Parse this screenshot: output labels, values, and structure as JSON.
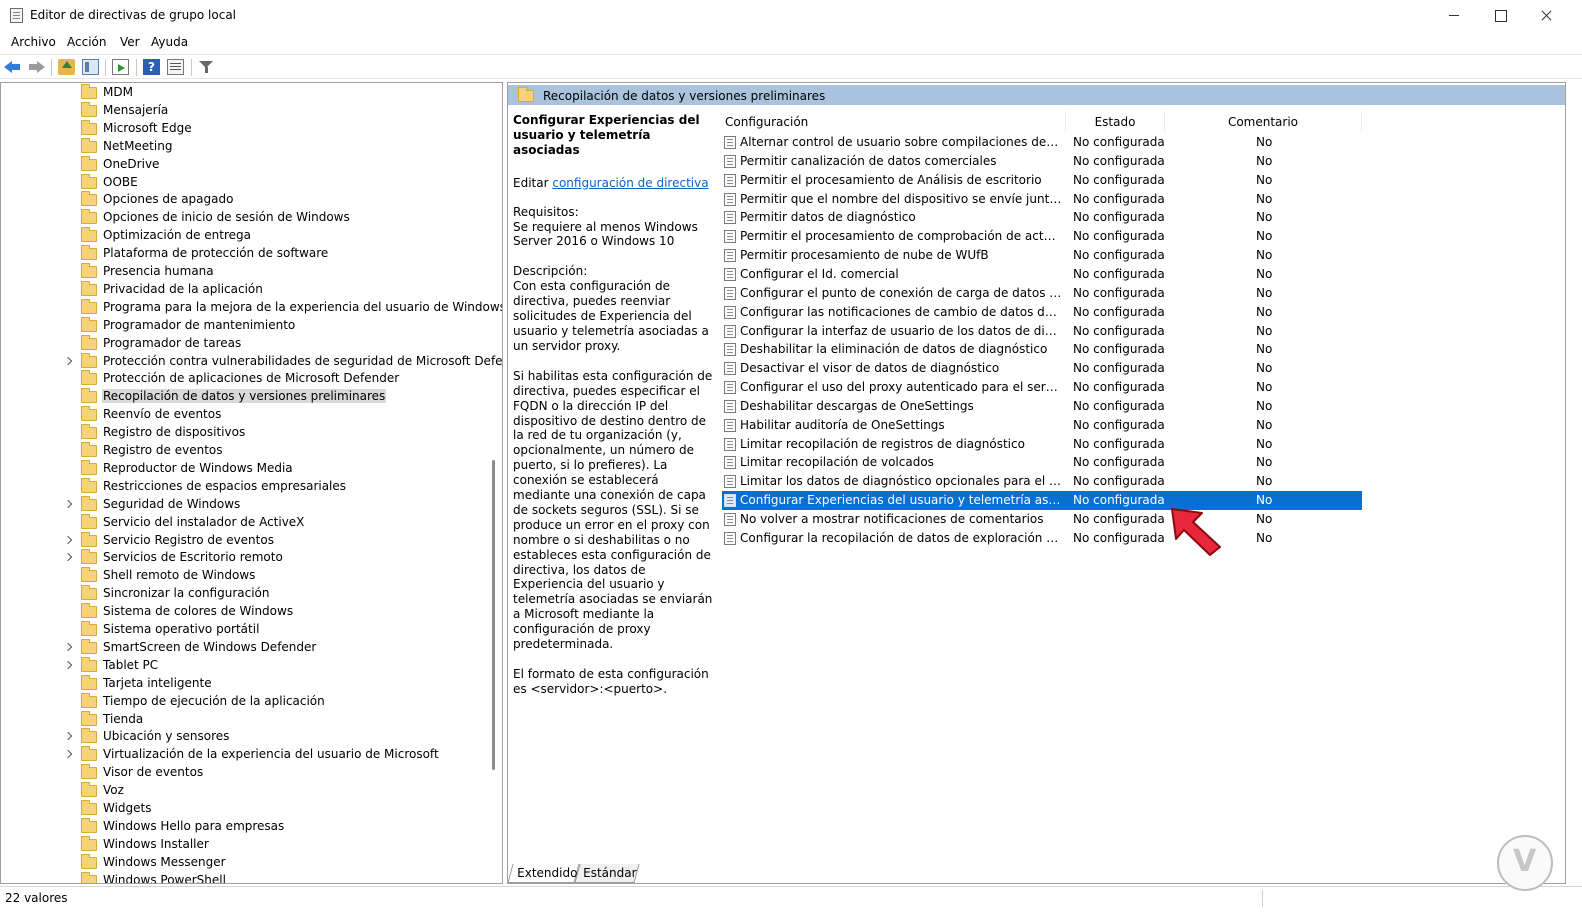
{
  "window": {
    "title": "Editor de directivas de grupo local"
  },
  "menu": [
    "Archivo",
    "Acción",
    "Ver",
    "Ayuda"
  ],
  "toolbar": {
    "icons": [
      "back-arrow",
      "forward-arrow",
      "up-folder",
      "show-hide-tree",
      "export-list",
      "help",
      "properties",
      "filter"
    ],
    "help_glyph": "?"
  },
  "tree": {
    "items": [
      {
        "label": "MDM",
        "expandable": false
      },
      {
        "label": "Mensajería",
        "expandable": false
      },
      {
        "label": "Microsoft Edge",
        "expandable": false
      },
      {
        "label": "NetMeeting",
        "expandable": false
      },
      {
        "label": "OneDrive",
        "expandable": false
      },
      {
        "label": "OOBE",
        "expandable": false
      },
      {
        "label": "Opciones de apagado",
        "expandable": false
      },
      {
        "label": "Opciones de inicio de sesión de Windows",
        "expandable": false
      },
      {
        "label": "Optimización de entrega",
        "expandable": false
      },
      {
        "label": "Plataforma de protección de software",
        "expandable": false
      },
      {
        "label": "Presencia humana",
        "expandable": false
      },
      {
        "label": "Privacidad de la aplicación",
        "expandable": false
      },
      {
        "label": "Programa para la mejora de la experiencia del usuario de Windows",
        "expandable": false
      },
      {
        "label": "Programador de mantenimiento",
        "expandable": false
      },
      {
        "label": "Programador de tareas",
        "expandable": false
      },
      {
        "label": "Protección contra vulnerabilidades de seguridad de Microsoft Defender",
        "expandable": true
      },
      {
        "label": "Protección de aplicaciones de Microsoft Defender",
        "expandable": false
      },
      {
        "label": "Recopilación de datos y versiones preliminares",
        "expandable": false,
        "selected": true
      },
      {
        "label": "Reenvío de eventos",
        "expandable": false
      },
      {
        "label": "Registro de dispositivos",
        "expandable": false
      },
      {
        "label": "Registro de eventos",
        "expandable": false
      },
      {
        "label": "Reproductor de Windows Media",
        "expandable": false
      },
      {
        "label": "Restricciones de espacios empresariales",
        "expandable": false
      },
      {
        "label": "Seguridad de Windows",
        "expandable": true
      },
      {
        "label": "Servicio del instalador de ActiveX",
        "expandable": false
      },
      {
        "label": "Servicio Registro de eventos",
        "expandable": true
      },
      {
        "label": "Servicios de Escritorio remoto",
        "expandable": true
      },
      {
        "label": "Shell remoto de Windows",
        "expandable": false
      },
      {
        "label": "Sincronizar la configuración",
        "expandable": false
      },
      {
        "label": "Sistema de colores de Windows",
        "expandable": false
      },
      {
        "label": "Sistema operativo portátil",
        "expandable": false
      },
      {
        "label": "SmartScreen de Windows Defender",
        "expandable": true
      },
      {
        "label": "Tablet PC",
        "expandable": true
      },
      {
        "label": "Tarjeta inteligente",
        "expandable": false
      },
      {
        "label": "Tiempo de ejecución de la aplicación",
        "expandable": false
      },
      {
        "label": "Tienda",
        "expandable": false
      },
      {
        "label": "Ubicación y sensores",
        "expandable": true
      },
      {
        "label": "Virtualización de la experiencia del usuario de Microsoft",
        "expandable": true
      },
      {
        "label": "Visor de eventos",
        "expandable": false
      },
      {
        "label": "Voz",
        "expandable": false
      },
      {
        "label": "Widgets",
        "expandable": false
      },
      {
        "label": "Windows Hello para empresas",
        "expandable": false
      },
      {
        "label": "Windows Installer",
        "expandable": false
      },
      {
        "label": "Windows Messenger",
        "expandable": false
      },
      {
        "label": "Windows PowerShell",
        "expandable": false
      }
    ]
  },
  "right_pane": {
    "header_title": "Recopilación de datos y versiones preliminares",
    "description": {
      "title": "Configurar Experiencias del usuario y telemetría asociadas",
      "edit_prefix": "Editar ",
      "edit_link": "configuración de directiva",
      "requirements_label": "Requisitos:",
      "requirements": "Se requiere al menos Windows Server 2016 o Windows 10",
      "description_label": "Descripción:",
      "description": "Con esta configuración de directiva, puedes reenviar solicitudes de Experiencia del usuario y telemetría asociadas a un servidor proxy.",
      "details": "Si habilitas esta configuración de directiva, puedes especificar el FQDN o la dirección IP del dispositivo de destino dentro de la red de tu organización (y, opcionalmente, un número de puerto, si lo prefieres). La conexión se establecerá mediante una conexión de capa de sockets seguros (SSL). Si se produce un error en el proxy con nombre o si deshabilitas o no estableces esta configuración de directiva, los datos de Experiencia del usuario y telemetría asociadas se enviarán a Microsoft mediante la configuración de proxy predeterminada.",
      "format": "El formato de esta configuración es <servidor>:<puerto>."
    },
    "columns": {
      "config": "Configuración",
      "estado": "Estado",
      "comentario": "Comentario"
    },
    "rows": [
      {
        "name": "Alternar control de usuario sobre compilaciones de Insider",
        "state": "No configurada",
        "comment": "No"
      },
      {
        "name": "Permitir canalización de datos comerciales",
        "state": "No configurada",
        "comment": "No"
      },
      {
        "name": "Permitir el procesamiento de Análisis de escritorio",
        "state": "No configurada",
        "comment": "No"
      },
      {
        "name": "Permitir que el nombre del dispositivo se envíe junto a los d...",
        "state": "No configurada",
        "comment": "No"
      },
      {
        "name": "Permitir datos de diagnóstico",
        "state": "No configurada",
        "comment": "No"
      },
      {
        "name": "Permitir el procesamiento de comprobación de actualizacio...",
        "state": "No configurada",
        "comment": "No"
      },
      {
        "name": "Permitir procesamiento de nube de WUfB",
        "state": "No configurada",
        "comment": "No"
      },
      {
        "name": "Configurar el Id. comercial",
        "state": "No configurada",
        "comment": "No"
      },
      {
        "name": "Configurar el punto de conexión de carga de datos de diagn...",
        "state": "No configurada",
        "comment": "No"
      },
      {
        "name": "Configurar las notificaciones de cambio de datos de diagnó...",
        "state": "No configurada",
        "comment": "No"
      },
      {
        "name": "Configurar la interfaz de usuario de los datos de diagnóstico",
        "state": "No configurada",
        "comment": "No"
      },
      {
        "name": "Deshabilitar la eliminación de datos de diagnóstico",
        "state": "No configurada",
        "comment": "No"
      },
      {
        "name": "Desactivar el visor de datos de diagnóstico",
        "state": "No configurada",
        "comment": "No"
      },
      {
        "name": "Configurar el uso del proxy autenticado para el servicio de E...",
        "state": "No configurada",
        "comment": "No"
      },
      {
        "name": "Deshabilitar descargas de OneSettings",
        "state": "No configurada",
        "comment": "No"
      },
      {
        "name": "Habilitar auditoría de OneSettings",
        "state": "No configurada",
        "comment": "No"
      },
      {
        "name": "Limitar recopilación de registros de diagnóstico",
        "state": "No configurada",
        "comment": "No"
      },
      {
        "name": "Limitar recopilación de volcados",
        "state": "No configurada",
        "comment": "No"
      },
      {
        "name": "Limitar los datos de diagnóstico opcionales para el análisis d...",
        "state": "No configurada",
        "comment": "No"
      },
      {
        "name": "Configurar Experiencias del usuario y telemetría asociadas",
        "state": "No configurada",
        "comment": "No",
        "selected": true
      },
      {
        "name": "No volver a mostrar notificaciones de comentarios",
        "state": "No configurada",
        "comment": "No"
      },
      {
        "name": "Configurar la recopilación de datos de exploración para Aná...",
        "state": "No configurada",
        "comment": "No"
      }
    ]
  },
  "tabs": [
    "Extendido",
    "Estándar"
  ],
  "status": {
    "text": "22 valores"
  },
  "colors": {
    "selection": "#0a6fd3",
    "header": "#a9c3dd",
    "link": "#0b64c8",
    "pointer": "#e8283a"
  }
}
